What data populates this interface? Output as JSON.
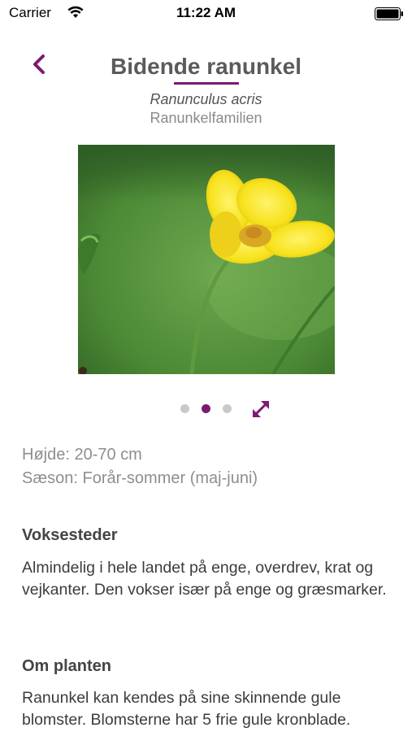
{
  "status_bar": {
    "carrier": "Carrier",
    "time": "11:22 AM",
    "icons": [
      "wifi-icon",
      "battery-icon"
    ]
  },
  "header": {
    "back_icon": "chevron-left-icon",
    "title": "Bidende ranunkel",
    "latin_name": "Ranunculus acris",
    "family": "Ranunkelfamilien"
  },
  "gallery": {
    "image_count": 3,
    "active_index": 1,
    "expand_icon": "expand-arrows-icon"
  },
  "facts": {
    "height": "Højde: 20-70 cm",
    "season": "Sæson: Forår-sommer (maj-juni)"
  },
  "sections": [
    {
      "heading": "Voksesteder",
      "body": "Almindelig i hele landet på enge, overdrev, krat og vejkanter. Den vokser især på enge og græsmarker."
    },
    {
      "heading": "Om planten",
      "body": "Ranunkel kan kendes på sine skinnende gule blomster. Blomsterne har 5 frie gule kronblade."
    }
  ],
  "colors": {
    "accent": "#7b1a72",
    "inactive_dot": "#c9c9c9"
  }
}
